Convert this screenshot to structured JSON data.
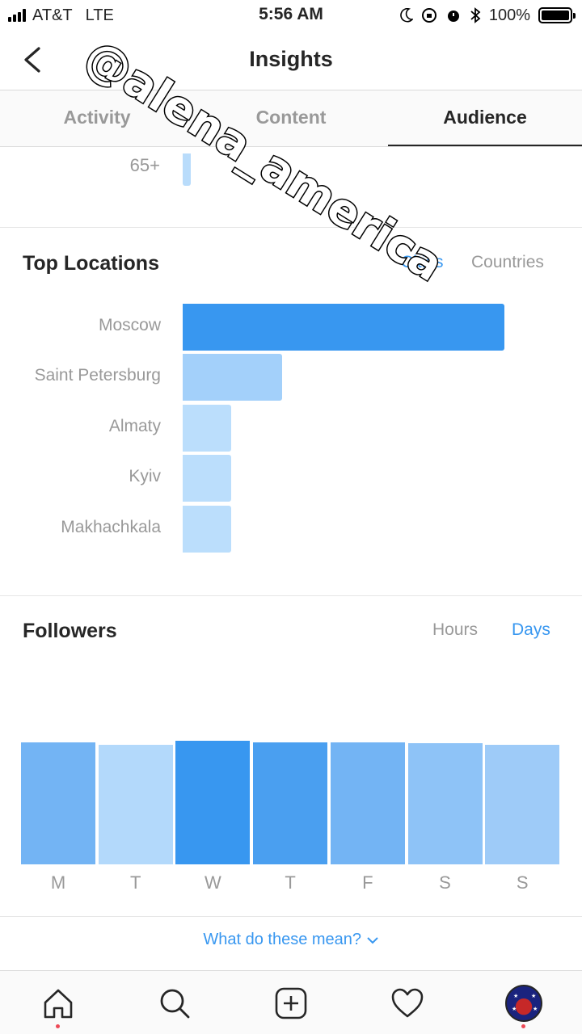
{
  "status_bar": {
    "carrier": "AT&T",
    "network": "LTE",
    "time": "5:56 AM",
    "battery": "100%",
    "battery_level": 1.0
  },
  "nav": {
    "title": "Insights",
    "back_icon": "chevron-left-icon"
  },
  "tabs": [
    {
      "label": "Activity",
      "active": false
    },
    {
      "label": "Content",
      "active": false
    },
    {
      "label": "Audience",
      "active": true
    }
  ],
  "age_fragment": {
    "label": "65+"
  },
  "top_locations": {
    "title": "Top Locations",
    "toggle_cities": "Cities",
    "toggle_countries": "Countries",
    "selected": "Cities",
    "chart_data": {
      "type": "bar",
      "orientation": "horizontal",
      "categories": [
        "Moscow",
        "Saint Petersburg",
        "Almaty",
        "Kyiv",
        "Makhachkala"
      ],
      "values": [
        100,
        31,
        15,
        15,
        15
      ],
      "colors": [
        "#3897f0",
        "#a3d0fa",
        "#bbdefc",
        "#bbdefc",
        "#bbdefc"
      ]
    }
  },
  "followers": {
    "title": "Followers",
    "toggle_hours": "Hours",
    "toggle_days": "Days",
    "selected": "Days",
    "chart_data": {
      "type": "bar",
      "categories": [
        "M",
        "T",
        "W",
        "T",
        "F",
        "S",
        "S"
      ],
      "values": [
        100,
        98,
        101,
        100,
        100,
        99,
        98
      ],
      "colors": [
        "#73b4f4",
        "#b3d9fb",
        "#3897f0",
        "#4a9ff0",
        "#73b4f4",
        "#8ec3f7",
        "#9ecbf8"
      ]
    }
  },
  "help_link": "What do these mean?",
  "bottom_bar": {
    "items": [
      "home-icon",
      "search-icon",
      "add-post-icon",
      "heart-icon",
      "profile-avatar"
    ]
  },
  "watermark": {
    "text": "@alena_america"
  }
}
